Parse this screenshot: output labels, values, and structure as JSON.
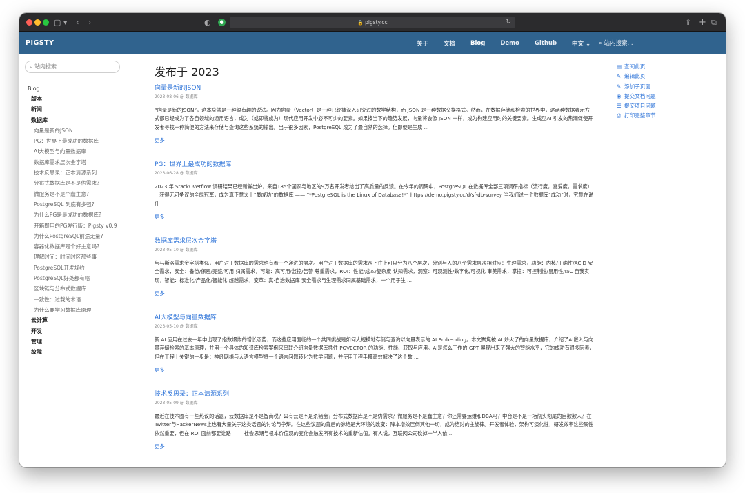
{
  "browser": {
    "url": "pigsty.cc"
  },
  "navbar": {
    "brand": "PIGSTY",
    "links": [
      "关于",
      "文档",
      "Blog",
      "Demo",
      "Github",
      "中文 ⌄"
    ],
    "active": "Blog",
    "search_placeholder": "站内搜索..."
  },
  "sidebar": {
    "search_placeholder": "站内搜索...",
    "root": "Blog",
    "sections": [
      {
        "label": "版本"
      },
      {
        "label": "新闻"
      },
      {
        "label": "数据库",
        "children": [
          "向量是新的JSON",
          "PG：世界上最成功的数据库",
          "AI大模型与向量数据库",
          "数据库需求层次金字塔",
          "技术反思录：正本清源系列",
          "分布式数据库是不是伪需求?",
          "微服务是不是个蠢主意?",
          "PostgreSQL 到底有多强?",
          "为什么PG是最成功的数据库?",
          "开箱即用的PG发行版：Pigsty v0.9",
          "为什么PostgreSQL前途无量?",
          "容器化数据库是个好主意吗?",
          "理解时间：时间时区那些事",
          "PostgreSQL开发规约",
          "PostgreSQL好处都有啥",
          "区块链与分布式数据库",
          "一致性：过载的术语",
          "为什么要学习数据库原理"
        ]
      },
      {
        "label": "云计算"
      },
      {
        "label": "开发"
      },
      {
        "label": "管理"
      },
      {
        "label": "故障"
      }
    ]
  },
  "main": {
    "page_title": "发布于 2023",
    "more_label": "更多",
    "posts": [
      {
        "title": "向量是新的JSON",
        "meta": "2023-08-06 @ 数据库",
        "excerpt": "“向量是新的JSON”，这本身就是一种很有趣的说法。因为向量（Vector）是一种已经被深入研究过的数学结构，而 JSON 是一种数据交换格式。然而，在数据存储和检索的世界中，这两种数据表示方式都已经成为了各自领域的通用语言，成为（或即将成为）现代应用开发中必不可少的要素。如果按当下的趋势发展，向量将会像 JSON 一样，成为构建应用时的关键要素。生成型AI 引发的热潮促使开发者寻找一种简便的方法来存储与查询这些系统的输出。出于很多因素，PostgreSQL 成为了最自然的选择。但即便是生成 ..."
      },
      {
        "title": "PG：世界上最成功的数据库",
        "meta": "2023-06-28 @ 数据库",
        "excerpt": "2023 年 StackOverflow 调研结果已经新鲜出炉，来自185个国家与地区的9万名开发者给出了高质量的反馈。在今年的调研中，PostgreSQL 在数据库全部三项调研指标（流行度，喜爱度，需求度）上获得无可争议的全能冠军，成为真正意义上“最成功”的数据库 —— “*PostgreSQL is the Linux of Database!*” https://demo.pigsty.cc/d/sf-db-survey 当我们说一个数据库“成功”时，究竟在说什 ..."
      },
      {
        "title": "数据库需求层次金字塔",
        "meta": "2023-05-10 @ 数据库",
        "excerpt": "与马斯洛需求金字塔类似，用户对于数据库的需求也有着一个递进的层次。用户对于数据库的需求从下往上可以分为八个层次，分别与人的八个需求层次相对应：生理需求，功能：内核/正确性/ACID 安全需求，安全：备份/保密/完整/可用 归属需求，可靠：高可用/监控/告警 尊重需求，ROI：性能/成本/复杂度 认知需求，洞察：可观测性/数字化/可视化 审美需求，掌控：可控制性/易用性/IaC 自我实现，智能：标准化/产品化/智能化 超越需求，变革：真·自治数据库 安全需求与生理需求同属基础需求，一个用于生 ..."
      },
      {
        "title": "AI大模型与向量数据库",
        "meta": "2023-05-10 @ 数据库",
        "excerpt": "新 AI 应用在过去一年中出现了指数爆炸的增长态势，而这些应用面临的一个共同挑战是如何大规模地存储与查询以向量表示的 AI Embedding。本文聚焦被 AI 炒火了的向量数据库，介绍了AI嵌入与向量存储检索的基本原理，并用一个具体的知识库检索案例来串联介绍向量数据库插件 PGVECTOR 的功能、性能、获取与应用。AI是怎么工作的 GPT 展现出来了强大的智能水平，它的成功有很多因素，但在工程上关键的一步是：神经网络与大语言模型将一个语言问题转化为数学问题，并使用工程手段高效解决了这个数 ..."
      },
      {
        "title": "技术反思录：正本清源系列",
        "meta": "2023-05-09 @ 数据库",
        "excerpt": "最近在技术圈有一些热议的话题，云数据库是不是智商税？公有云是不是杀猪盘？分布式数据库是不是伪需求？微服务是不是蠢主意？你还需要运维和DBA吗？中台是不是一场彻头彻尾的自欺欺人？在Twitter与HackerNews上也有大量关于这类话题的讨论与争辩。在这些议题的背后的脉络是大环境的改变：降本增效压倒其他一切，成为绝对的主旋律。开发者体验，架构可演化性，研发效率这些属性依然重要，但在 ROI 面前都要让路 —— 社会思潮与根本价值观的变化会触发所有技术的重新估值。有人说，互联网公司砍掉一半人依 ..."
      }
    ]
  },
  "toc": {
    "items": [
      {
        "label": "查阅此页",
        "icon": "file-icon"
      },
      {
        "label": "编辑此页",
        "icon": "edit-icon"
      },
      {
        "label": "添加子页面",
        "icon": "add-page-icon"
      },
      {
        "label": "提交文档问题",
        "icon": "github-icon"
      },
      {
        "label": "提交项目问题",
        "icon": "list-icon"
      },
      {
        "label": "打印完整章节",
        "icon": "print-icon"
      }
    ]
  }
}
